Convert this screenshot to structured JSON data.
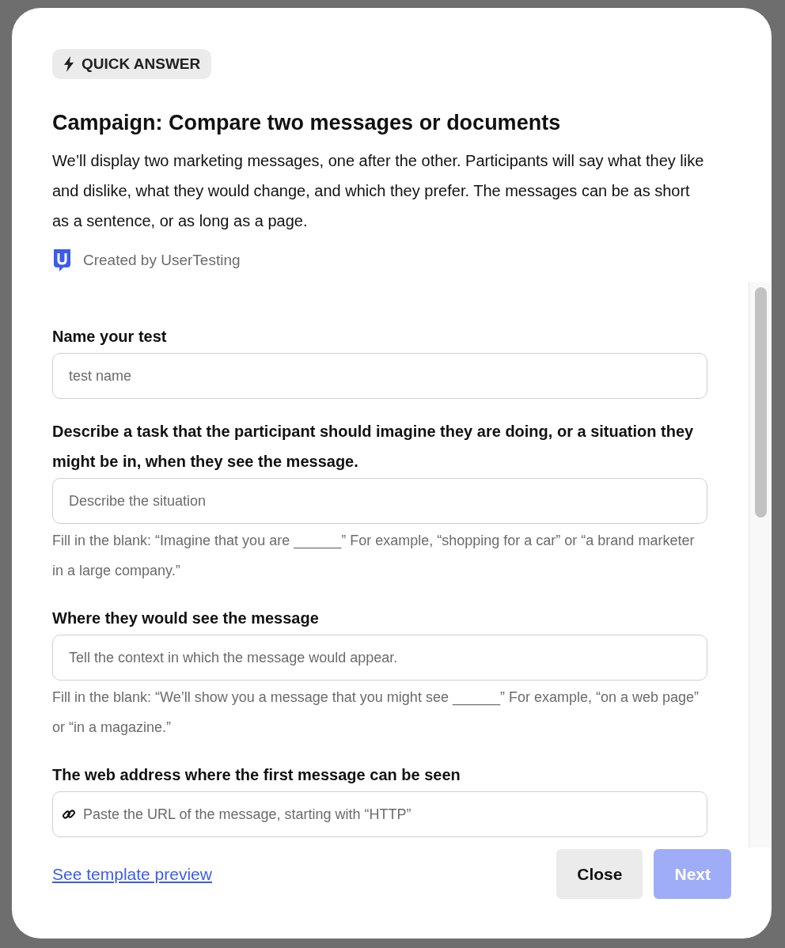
{
  "badge": {
    "label": "QUICK ANSWER"
  },
  "title": "Campaign: Compare two messages or documents",
  "description": "We’ll display two marketing messages, one after the other. Participants will say what they like and dislike, what they would change, and which they prefer. The messages can be as short as a sentence, or as long as a page.",
  "author": {
    "text": "Created by UserTesting"
  },
  "fields": [
    {
      "kind": "text",
      "label": "Name your test",
      "placeholder": "test name"
    },
    {
      "kind": "text",
      "label": "Describe a task that the participant should imagine they are doing, or a situation they might be in, when they see the message.",
      "placeholder": "Describe the situation",
      "hint": "Fill in the blank: “Imagine that you are ______” For example, “shopping for a car” or “a brand marketer in a large company.”"
    },
    {
      "kind": "text",
      "label": "Where they would see the message",
      "placeholder": "Tell the context in which the message would appear.",
      "hint": "Fill in the blank: “We’ll show you a message that you might see ______” For example, “on a web page” or “in a magazine.”"
    },
    {
      "kind": "url",
      "label": "The web address where the first message can be seen",
      "placeholder": "Paste the URL of the message, starting with “HTTP”"
    }
  ],
  "footer": {
    "link": "See template preview",
    "buttons": [
      {
        "label": "Close",
        "kind": "secondary",
        "disabled": false
      },
      {
        "label": "Next",
        "kind": "primary",
        "disabled": true
      }
    ]
  }
}
